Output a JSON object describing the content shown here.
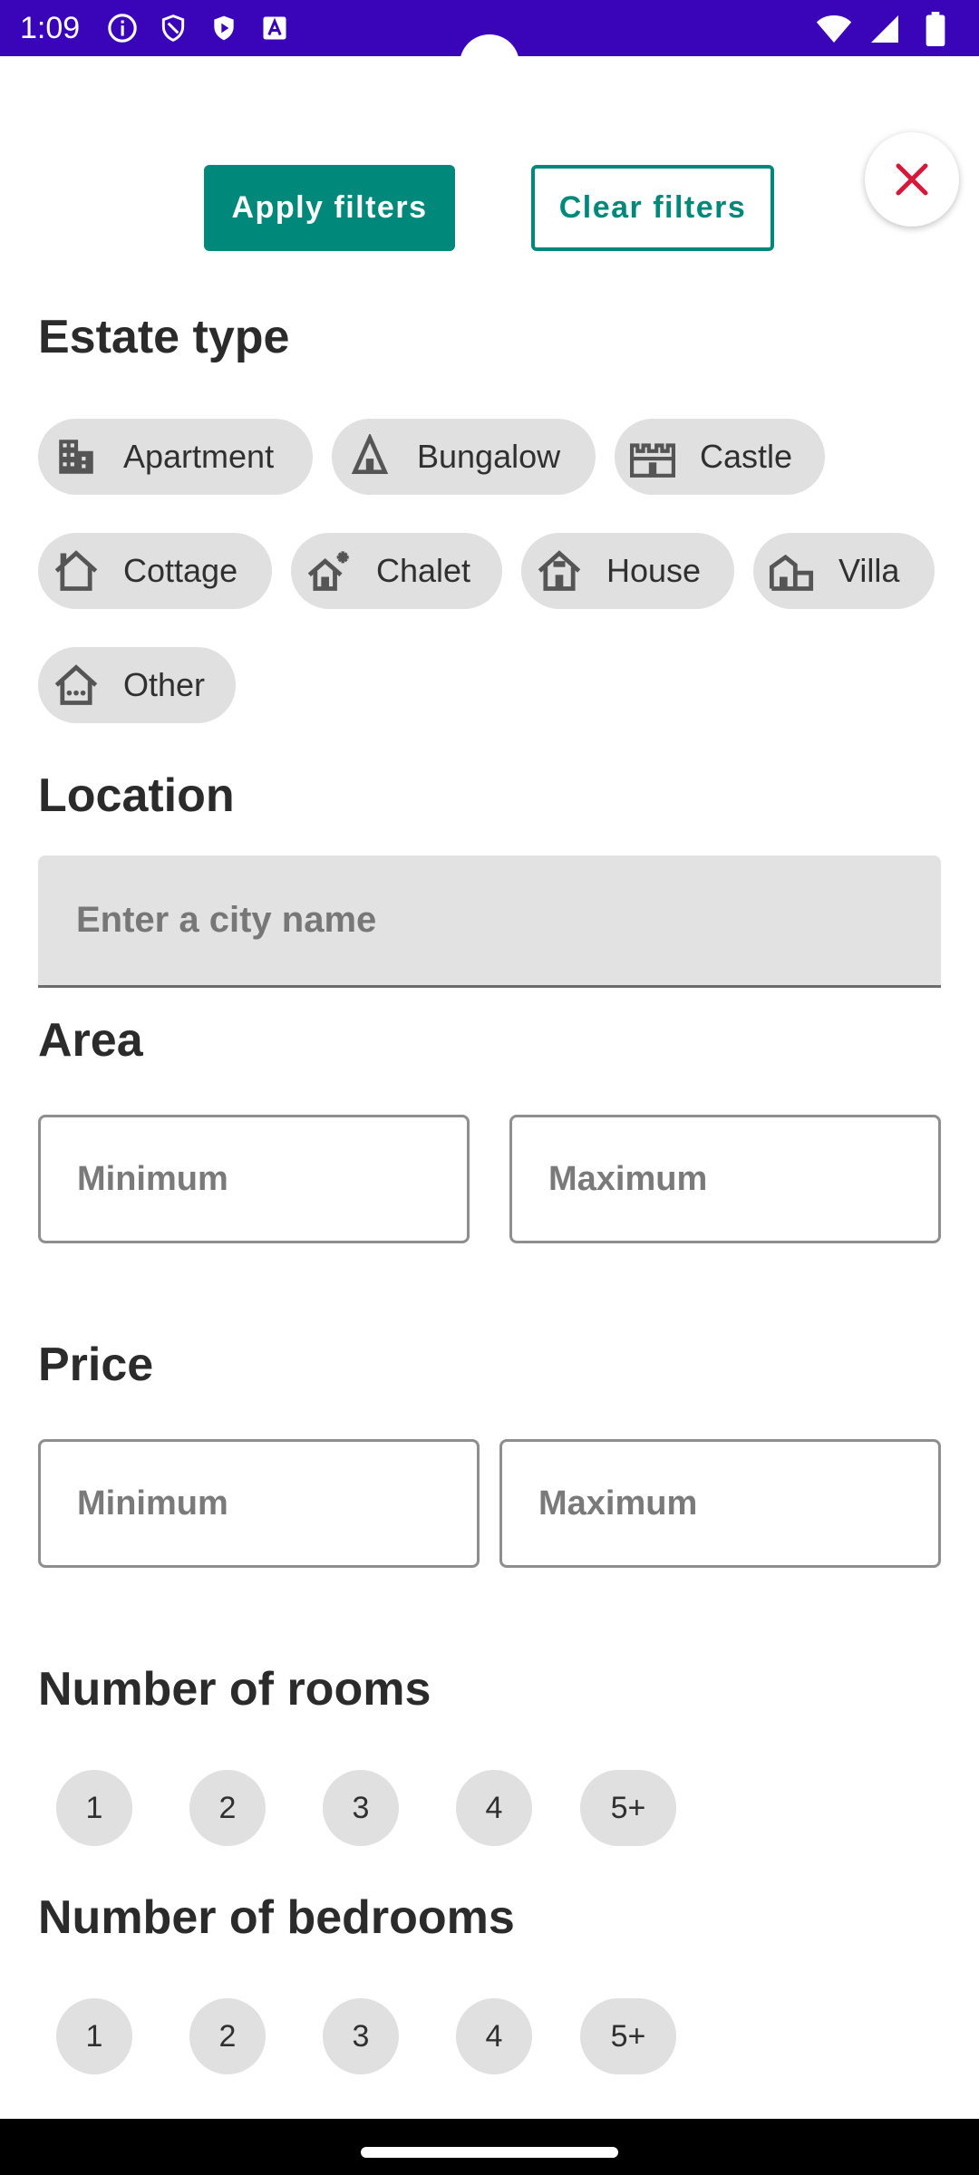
{
  "status_bar": {
    "time": "1:09",
    "left_icons": [
      "info-icon",
      "shield-icon",
      "play-shield-icon",
      "a-badge-icon"
    ],
    "right_icons": [
      "wifi-icon",
      "signal-icon",
      "battery-icon"
    ],
    "background": "#3a04b8"
  },
  "toolbar": {
    "apply_label": "Apply filters",
    "clear_label": "Clear filters",
    "accent": "#00897b",
    "close_color": "#d6183b"
  },
  "estate_type": {
    "title": "Estate type",
    "chips": [
      {
        "label": "Apartment",
        "icon": "apartment-icon"
      },
      {
        "label": "Bungalow",
        "icon": "bungalow-icon"
      },
      {
        "label": "Castle",
        "icon": "castle-icon"
      },
      {
        "label": "Cottage",
        "icon": "cottage-icon"
      },
      {
        "label": "Chalet",
        "icon": "chalet-icon"
      },
      {
        "label": "House",
        "icon": "house-icon"
      },
      {
        "label": "Villa",
        "icon": "villa-icon"
      },
      {
        "label": "Other",
        "icon": "other-home-icon"
      }
    ]
  },
  "location": {
    "title": "Location",
    "placeholder": "Enter a city name",
    "value": ""
  },
  "area": {
    "title": "Area",
    "min_placeholder": "Minimum",
    "max_placeholder": "Maximum"
  },
  "price": {
    "title": "Price",
    "min_placeholder": "Minimum",
    "max_placeholder": "Maximum"
  },
  "rooms": {
    "title": "Number of rooms",
    "options": [
      "1",
      "2",
      "3",
      "4",
      "5+"
    ]
  },
  "bedrooms": {
    "title": "Number of bedrooms",
    "options": [
      "1",
      "2",
      "3",
      "4",
      "5+"
    ]
  }
}
